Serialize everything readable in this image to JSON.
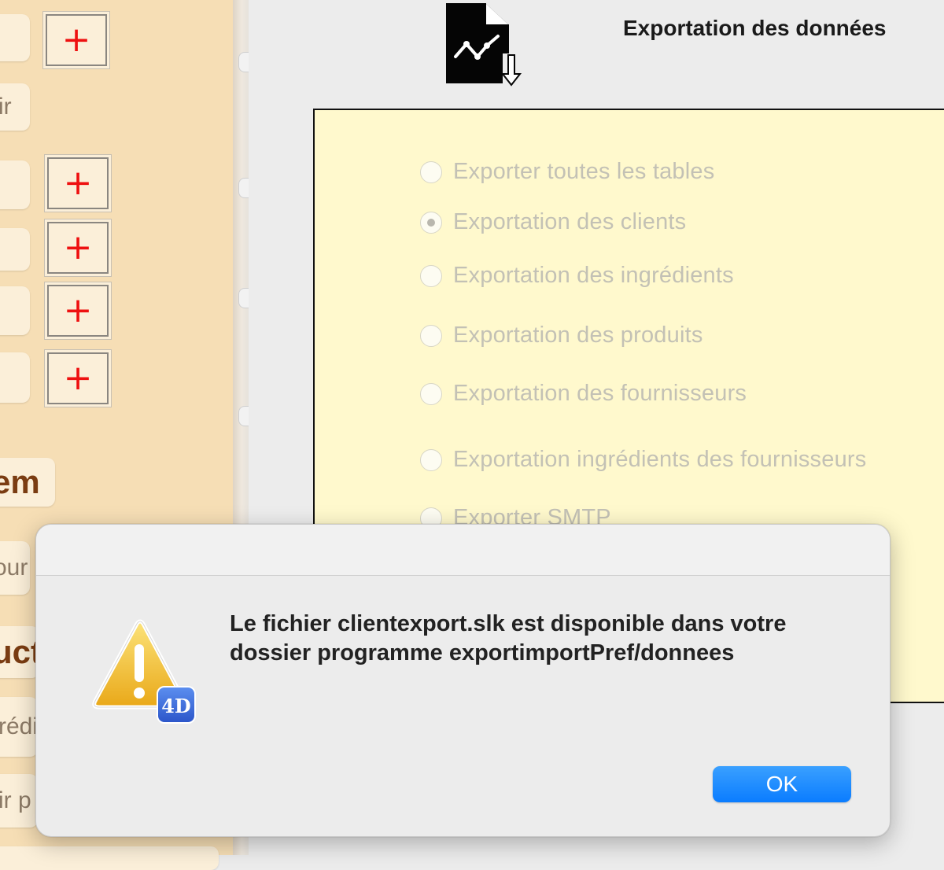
{
  "sidebar": {
    "partial_labels": [
      {
        "id": "pill-1",
        "text": ""
      },
      {
        "id": "pill-2",
        "text": "ir"
      },
      {
        "id": "pill-3",
        "text": ""
      },
      {
        "id": "pill-4",
        "text": ""
      },
      {
        "id": "pill-5",
        "text": ""
      },
      {
        "id": "pill-6",
        "text": ""
      },
      {
        "id": "pill-7",
        "text": "em"
      },
      {
        "id": "pill-8",
        "text": "our"
      },
      {
        "id": "pill-9",
        "text": "uct"
      },
      {
        "id": "pill-10",
        "text": "rédi"
      },
      {
        "id": "pill-11",
        "text": "ir p"
      }
    ],
    "add_buttons": [
      "+",
      "+",
      "+",
      "+",
      "+"
    ]
  },
  "export_window": {
    "title": "Exportation des données",
    "icon": "chart-export-document-icon",
    "options": [
      {
        "label": "Exporter toutes les tables",
        "checked": false
      },
      {
        "label": "Exportation des clients",
        "checked": true
      },
      {
        "label": "Exportation des ingrédients",
        "checked": false
      },
      {
        "label": "Exportation des produits",
        "checked": false
      },
      {
        "label": "Exportation des fournisseurs",
        "checked": false
      },
      {
        "label": "Exportation ingrédients des fournisseurs",
        "checked": false
      },
      {
        "label": "Exporter SMTP",
        "checked": false
      }
    ]
  },
  "dialog": {
    "message_line1": "Le fichier clientexport.slk est disponible dans votre",
    "message_line2": "dossier programme exportimportPref/donnees",
    "ok_label": "OK",
    "icon": "warning-4d-icon",
    "badge_text": "4D"
  },
  "colors": {
    "sidebar_bg": "#f6deb5",
    "panel_bg": "#fff9cd",
    "plus_red": "#ee1010",
    "ok_blue": "#0a7cff"
  }
}
